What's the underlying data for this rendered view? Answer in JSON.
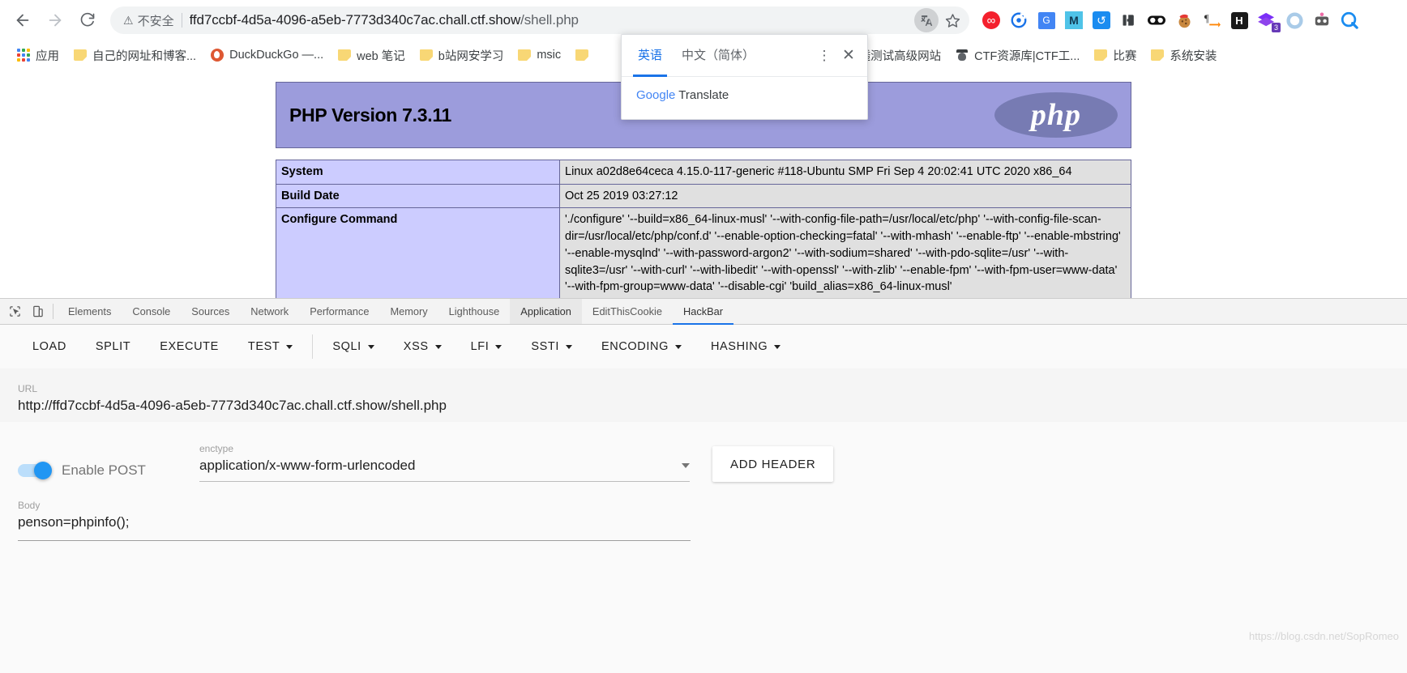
{
  "browser": {
    "nav": {
      "back_label": "Back",
      "forward_label": "Forward",
      "reload_label": "Reload"
    },
    "omnibox": {
      "security_text": "不安全",
      "url_main": "ffd7ccbf-4d5a-4096-a5eb-7773d340c7ac.chall.ctf.show",
      "url_path": "/shell.php",
      "translate_icon": "translate-icon",
      "star_icon": "bookmark-star-icon"
    },
    "extensions": [
      {
        "name": "infinity-icon",
        "glyph": "∞",
        "color": "#ffffff",
        "bg": "#f4202d"
      },
      {
        "name": "target-icon",
        "glyph": "◉",
        "color": "#1a73e8",
        "bg": "transparent"
      },
      {
        "name": "google-translate-icon",
        "glyph": "G",
        "color": "#ffffff",
        "bg": "#4285f4"
      },
      {
        "name": "markdown-icon",
        "glyph": "M",
        "color": "#1a3a52",
        "bg": "#4fc3e8"
      },
      {
        "name": "history-icon",
        "glyph": "↺",
        "color": "#ffffff",
        "bg": "#1a8cf0"
      },
      {
        "name": "puzzle-icon",
        "glyph": "❙❱",
        "color": "#3c4043",
        "bg": "transparent"
      },
      {
        "name": "glasses-icon",
        "glyph": "◖◗",
        "color": "#111111",
        "bg": "transparent"
      },
      {
        "name": "cookie-santa-icon",
        "glyph": "🍪",
        "color": "#c98f4e",
        "bg": "transparent"
      },
      {
        "name": "paragraph-arrow-icon",
        "glyph": "¶",
        "color": "#333333",
        "bg": "transparent"
      },
      {
        "name": "hackbar-h-icon",
        "glyph": "H",
        "color": "#ffffff",
        "bg": "#1a1a1a"
      },
      {
        "name": "layers-icon",
        "glyph": "◆",
        "color": "#7b2ff7",
        "bg": "transparent",
        "badge": "3"
      },
      {
        "name": "ring-icon",
        "glyph": "◍",
        "color": "#9fc6e8",
        "bg": "transparent"
      },
      {
        "name": "mask-robot-icon",
        "glyph": "⬛",
        "color": "#4a4a4a",
        "bg": "transparent"
      },
      {
        "name": "search-circle-icon",
        "glyph": "Q",
        "color": "#1a8cf0",
        "bg": "transparent"
      }
    ],
    "bookmarks": [
      {
        "label": "应用",
        "icon": "apps-grid-icon"
      },
      {
        "label": "自己的网址和博客...",
        "icon": "folder-icon"
      },
      {
        "label": "DuckDuckGo —...",
        "icon": "duckduckgo-icon"
      },
      {
        "label": "web 笔记",
        "icon": "folder-icon"
      },
      {
        "label": "b站网安学习",
        "icon": "folder-icon"
      },
      {
        "label": "msic",
        "icon": "folder-icon"
      },
      {
        "label": "",
        "icon": "folder-icon"
      },
      {
        "label": "参透测试高级网站",
        "icon": "folder-icon"
      },
      {
        "label": "CTF资源库|CTF工...",
        "icon": "spy-icon"
      },
      {
        "label": "比赛",
        "icon": "folder-icon"
      },
      {
        "label": "系统安装",
        "icon": "folder-icon"
      }
    ]
  },
  "translate_popup": {
    "tabs": [
      {
        "label": "英语",
        "active": true
      },
      {
        "label": "中文（简体）",
        "active": false
      }
    ],
    "more_icon": "more-vertical-icon",
    "close_icon": "close-icon",
    "footer_brand": "Google",
    "footer_text": " Translate"
  },
  "phpinfo": {
    "version_title": "PHP Version 7.3.11",
    "logo_text": "php",
    "rows": [
      {
        "key": "System",
        "value": "Linux a02d8e64ceca 4.15.0-117-generic #118-Ubuntu SMP Fri Sep 4 20:02:41 UTC 2020 x86_64"
      },
      {
        "key": "Build Date",
        "value": "Oct 25 2019 03:27:12"
      },
      {
        "key": "Configure Command",
        "value": "'./configure'  '--build=x86_64-linux-musl' '--with-config-file-path=/usr/local/etc/php' '--with-config-file-scan-dir=/usr/local/etc/php/conf.d' '--enable-option-checking=fatal' '--with-mhash' '--enable-ftp' '--enable-mbstring' '--enable-mysqlnd' '--with-password-argon2' '--with-sodium=shared' '--with-pdo-sqlite=/usr' '--with-sqlite3=/usr' '--with-curl' '--with-libedit' '--with-openssl' '--with-zlib' '--enable-fpm' '--with-fpm-user=www-data' '--with-fpm-group=www-data' '--disable-cgi' 'build_alias=x86_64-linux-musl'"
      }
    ]
  },
  "devtools": {
    "inspect_icon": "inspect-element-icon",
    "device_icon": "device-toolbar-icon",
    "tabs": [
      {
        "label": "Elements",
        "state": "normal"
      },
      {
        "label": "Console",
        "state": "normal"
      },
      {
        "label": "Sources",
        "state": "normal"
      },
      {
        "label": "Network",
        "state": "normal"
      },
      {
        "label": "Performance",
        "state": "normal"
      },
      {
        "label": "Memory",
        "state": "normal"
      },
      {
        "label": "Lighthouse",
        "state": "normal"
      },
      {
        "label": "Application",
        "state": "selected"
      },
      {
        "label": "EditThisCookie",
        "state": "normal"
      },
      {
        "label": "HackBar",
        "state": "active"
      }
    ]
  },
  "hackbar": {
    "toolbar": [
      {
        "label": "LOAD",
        "caret": false
      },
      {
        "label": "SPLIT",
        "caret": false
      },
      {
        "label": "EXECUTE",
        "caret": false
      },
      {
        "label": "TEST",
        "caret": true
      },
      {
        "label": "SQLI",
        "caret": true,
        "divider_before": true
      },
      {
        "label": "XSS",
        "caret": true
      },
      {
        "label": "LFI",
        "caret": true
      },
      {
        "label": "SSTI",
        "caret": true
      },
      {
        "label": "ENCODING",
        "caret": true
      },
      {
        "label": "HASHING",
        "caret": true
      }
    ],
    "url_label": "URL",
    "url_value": "http://ffd7ccbf-4d5a-4096-a5eb-7773d340c7ac.chall.ctf.show/shell.php",
    "post_toggle_label": "Enable POST",
    "post_toggle_on": true,
    "enctype_label": "enctype",
    "enctype_value": "application/x-www-form-urlencoded",
    "add_header_label": "ADD HEADER",
    "body_label": "Body",
    "body_value": "penson=phpinfo();"
  },
  "watermark": "https://blog.csdn.net/SopRomeo"
}
